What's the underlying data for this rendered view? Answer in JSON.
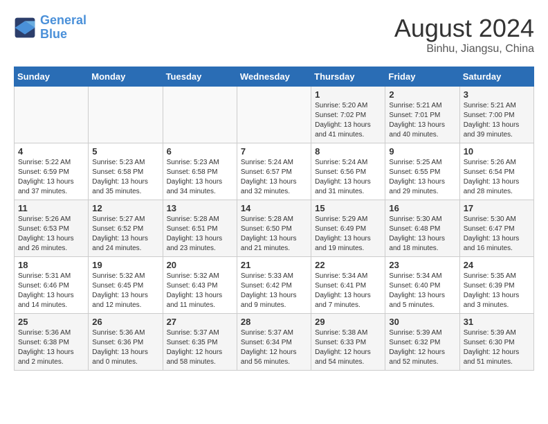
{
  "logo": {
    "line1": "General",
    "line2": "Blue"
  },
  "title": "August 2024",
  "location": "Binhu, Jiangsu, China",
  "weekdays": [
    "Sunday",
    "Monday",
    "Tuesday",
    "Wednesday",
    "Thursday",
    "Friday",
    "Saturday"
  ],
  "weeks": [
    [
      {
        "day": "",
        "info": ""
      },
      {
        "day": "",
        "info": ""
      },
      {
        "day": "",
        "info": ""
      },
      {
        "day": "",
        "info": ""
      },
      {
        "day": "1",
        "info": "Sunrise: 5:20 AM\nSunset: 7:02 PM\nDaylight: 13 hours\nand 41 minutes."
      },
      {
        "day": "2",
        "info": "Sunrise: 5:21 AM\nSunset: 7:01 PM\nDaylight: 13 hours\nand 40 minutes."
      },
      {
        "day": "3",
        "info": "Sunrise: 5:21 AM\nSunset: 7:00 PM\nDaylight: 13 hours\nand 39 minutes."
      }
    ],
    [
      {
        "day": "4",
        "info": "Sunrise: 5:22 AM\nSunset: 6:59 PM\nDaylight: 13 hours\nand 37 minutes."
      },
      {
        "day": "5",
        "info": "Sunrise: 5:23 AM\nSunset: 6:58 PM\nDaylight: 13 hours\nand 35 minutes."
      },
      {
        "day": "6",
        "info": "Sunrise: 5:23 AM\nSunset: 6:58 PM\nDaylight: 13 hours\nand 34 minutes."
      },
      {
        "day": "7",
        "info": "Sunrise: 5:24 AM\nSunset: 6:57 PM\nDaylight: 13 hours\nand 32 minutes."
      },
      {
        "day": "8",
        "info": "Sunrise: 5:24 AM\nSunset: 6:56 PM\nDaylight: 13 hours\nand 31 minutes."
      },
      {
        "day": "9",
        "info": "Sunrise: 5:25 AM\nSunset: 6:55 PM\nDaylight: 13 hours\nand 29 minutes."
      },
      {
        "day": "10",
        "info": "Sunrise: 5:26 AM\nSunset: 6:54 PM\nDaylight: 13 hours\nand 28 minutes."
      }
    ],
    [
      {
        "day": "11",
        "info": "Sunrise: 5:26 AM\nSunset: 6:53 PM\nDaylight: 13 hours\nand 26 minutes."
      },
      {
        "day": "12",
        "info": "Sunrise: 5:27 AM\nSunset: 6:52 PM\nDaylight: 13 hours\nand 24 minutes."
      },
      {
        "day": "13",
        "info": "Sunrise: 5:28 AM\nSunset: 6:51 PM\nDaylight: 13 hours\nand 23 minutes."
      },
      {
        "day": "14",
        "info": "Sunrise: 5:28 AM\nSunset: 6:50 PM\nDaylight: 13 hours\nand 21 minutes."
      },
      {
        "day": "15",
        "info": "Sunrise: 5:29 AM\nSunset: 6:49 PM\nDaylight: 13 hours\nand 19 minutes."
      },
      {
        "day": "16",
        "info": "Sunrise: 5:30 AM\nSunset: 6:48 PM\nDaylight: 13 hours\nand 18 minutes."
      },
      {
        "day": "17",
        "info": "Sunrise: 5:30 AM\nSunset: 6:47 PM\nDaylight: 13 hours\nand 16 minutes."
      }
    ],
    [
      {
        "day": "18",
        "info": "Sunrise: 5:31 AM\nSunset: 6:46 PM\nDaylight: 13 hours\nand 14 minutes."
      },
      {
        "day": "19",
        "info": "Sunrise: 5:32 AM\nSunset: 6:45 PM\nDaylight: 13 hours\nand 12 minutes."
      },
      {
        "day": "20",
        "info": "Sunrise: 5:32 AM\nSunset: 6:43 PM\nDaylight: 13 hours\nand 11 minutes."
      },
      {
        "day": "21",
        "info": "Sunrise: 5:33 AM\nSunset: 6:42 PM\nDaylight: 13 hours\nand 9 minutes."
      },
      {
        "day": "22",
        "info": "Sunrise: 5:34 AM\nSunset: 6:41 PM\nDaylight: 13 hours\nand 7 minutes."
      },
      {
        "day": "23",
        "info": "Sunrise: 5:34 AM\nSunset: 6:40 PM\nDaylight: 13 hours\nand 5 minutes."
      },
      {
        "day": "24",
        "info": "Sunrise: 5:35 AM\nSunset: 6:39 PM\nDaylight: 13 hours\nand 3 minutes."
      }
    ],
    [
      {
        "day": "25",
        "info": "Sunrise: 5:36 AM\nSunset: 6:38 PM\nDaylight: 13 hours\nand 2 minutes."
      },
      {
        "day": "26",
        "info": "Sunrise: 5:36 AM\nSunset: 6:36 PM\nDaylight: 13 hours\nand 0 minutes."
      },
      {
        "day": "27",
        "info": "Sunrise: 5:37 AM\nSunset: 6:35 PM\nDaylight: 12 hours\nand 58 minutes."
      },
      {
        "day": "28",
        "info": "Sunrise: 5:37 AM\nSunset: 6:34 PM\nDaylight: 12 hours\nand 56 minutes."
      },
      {
        "day": "29",
        "info": "Sunrise: 5:38 AM\nSunset: 6:33 PM\nDaylight: 12 hours\nand 54 minutes."
      },
      {
        "day": "30",
        "info": "Sunrise: 5:39 AM\nSunset: 6:32 PM\nDaylight: 12 hours\nand 52 minutes."
      },
      {
        "day": "31",
        "info": "Sunrise: 5:39 AM\nSunset: 6:30 PM\nDaylight: 12 hours\nand 51 minutes."
      }
    ]
  ]
}
